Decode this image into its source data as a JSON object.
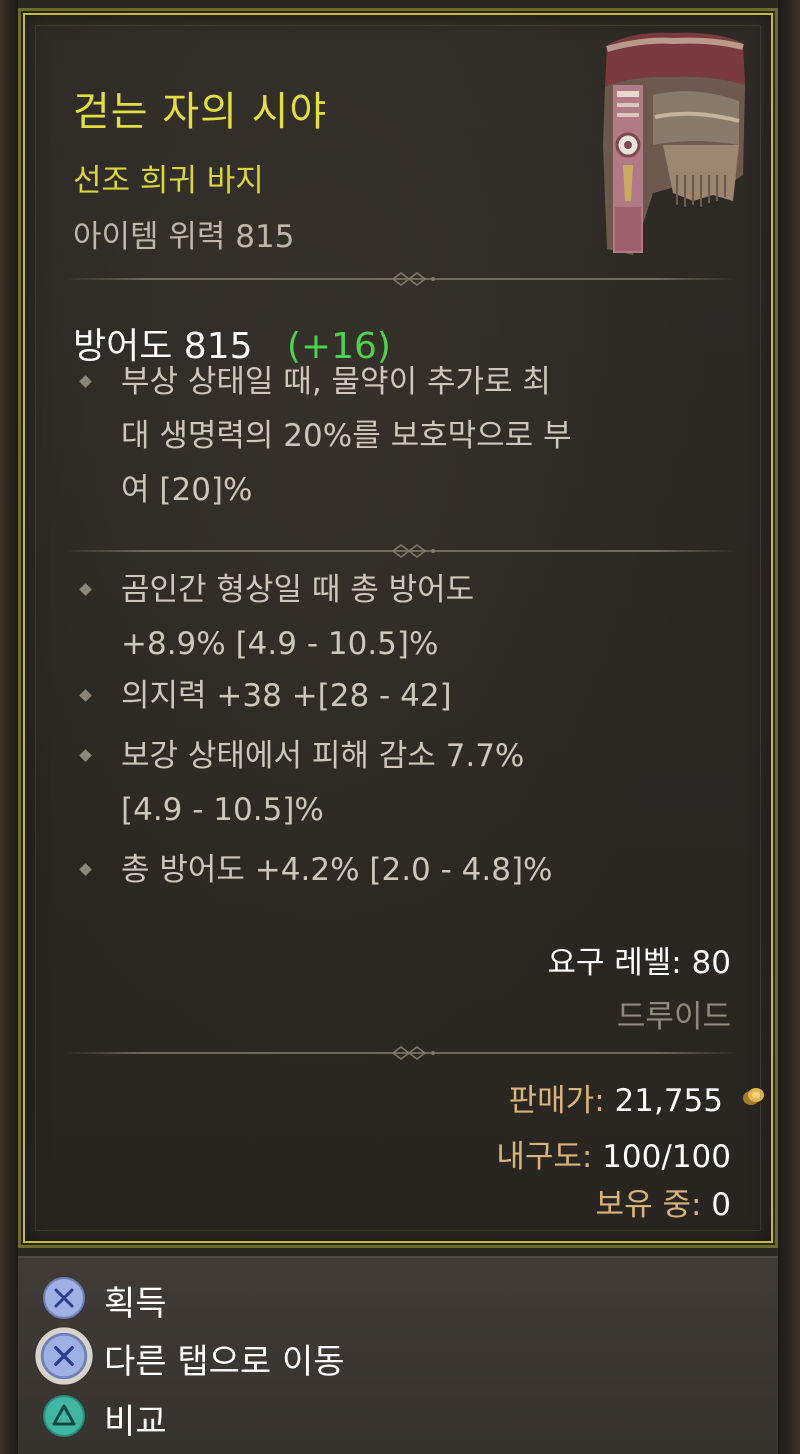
{
  "item": {
    "name": "걷는 자의 시야",
    "type": "선조 희귀 바지",
    "power_label": "아이템 위력 815",
    "image_icon": "pants-item-icon"
  },
  "armor": {
    "text": "방어도 815",
    "bonus": "(+16)"
  },
  "aspect": {
    "lines": [
      "부상 상태일 때, 물약이 추가로 최",
      "대 생명력의 20%를 보호막으로 부",
      "여 [20]%"
    ]
  },
  "affixes": [
    {
      "lines": [
        "곰인간 형상일 때 총 방어도",
        "+8.9% [4.9 - 10.5]%"
      ]
    },
    {
      "lines": [
        "의지력 +38 +[28 - 42]"
      ]
    },
    {
      "lines": [
        "보강 상태에서 피해 감소 7.7%",
        "[4.9 - 10.5]%"
      ]
    },
    {
      "lines": [
        "총 방어도 +4.2% [2.0 - 4.8]%"
      ]
    }
  ],
  "requirements": {
    "level": "요구 레벨: 80",
    "class": "드루이드"
  },
  "stats": {
    "sell_label": "판매가:",
    "sell_value": "21,755",
    "durability_label": "내구도:",
    "durability_value": "100/100",
    "owned_label": "보유 중:",
    "owned_value": "0"
  },
  "actions": [
    {
      "label": "획득",
      "icon": "cross-button-icon"
    },
    {
      "label": "다른 탭으로 이동",
      "icon": "cross-button-icon"
    },
    {
      "label": "비교",
      "icon": "triangle-button-icon"
    }
  ],
  "colors": {
    "legendary_name": "#e2df3f",
    "bonus_green": "#4cd34c",
    "stat_label_gold": "#d9b47a",
    "border_yellow": "#c2bb3a"
  }
}
